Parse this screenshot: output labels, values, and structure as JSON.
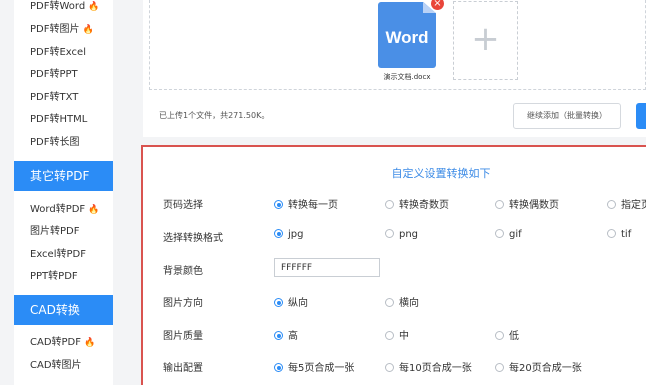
{
  "sidebar": {
    "pdf_convert": [
      {
        "label": "PDF转Word",
        "hot": true
      },
      {
        "label": "PDF转图片",
        "hot": true
      },
      {
        "label": "PDF转Excel",
        "hot": false
      },
      {
        "label": "PDF转PPT",
        "hot": false
      },
      {
        "label": "PDF转TXT",
        "hot": false
      },
      {
        "label": "PDF转HTML",
        "hot": false
      },
      {
        "label": "PDF转长图",
        "hot": false
      }
    ],
    "section_other": "其它转PDF",
    "other_items": [
      {
        "label": "Word转PDF",
        "hot": true
      },
      {
        "label": "图片转PDF",
        "hot": false
      },
      {
        "label": "Excel转PDF",
        "hot": false
      },
      {
        "label": "PPT转PDF",
        "hot": false
      }
    ],
    "section_cad": "CAD转换",
    "cad_items": [
      {
        "label": "CAD转PDF",
        "hot": true
      },
      {
        "label": "CAD转图片",
        "hot": false
      }
    ],
    "hot_icon": "fire-icon"
  },
  "upload": {
    "file_icon_text": "Word",
    "file_name": "演示文档.docx",
    "add_icon": "plus-icon",
    "status": "已上传1个文件，共271.50K。",
    "continue_button": "继续添加（批量转换）"
  },
  "settings": {
    "title": "自定义设置转换如下",
    "rows": {
      "page_select": {
        "label": "页码选择",
        "options": [
          "转换每一页",
          "转换奇数页",
          "转换偶数页",
          "指定页"
        ],
        "selected": 0
      },
      "format": {
        "label": "选择转换格式",
        "options": [
          "jpg",
          "png",
          "gif",
          "tif"
        ],
        "selected": 0
      },
      "bg_color": {
        "label": "背景颜色",
        "value": "FFFFFF"
      },
      "orientation": {
        "label": "图片方向",
        "options": [
          "纵向",
          "横向"
        ],
        "selected": 0
      },
      "quality": {
        "label": "图片质量",
        "options": [
          "高",
          "中",
          "低"
        ],
        "selected": 0
      },
      "output": {
        "label": "输出配置",
        "options": [
          "每5页合成一张",
          "每10页合成一张",
          "每20页合成一张"
        ],
        "selected": 0
      }
    }
  },
  "colors": {
    "accent": "#2b8cf6",
    "hot": "#ff6a2b",
    "panel_border": "#d9534f",
    "title_blue": "#3c8be6",
    "word_doc": "#4a8fe6",
    "remove": "#e9453a"
  }
}
